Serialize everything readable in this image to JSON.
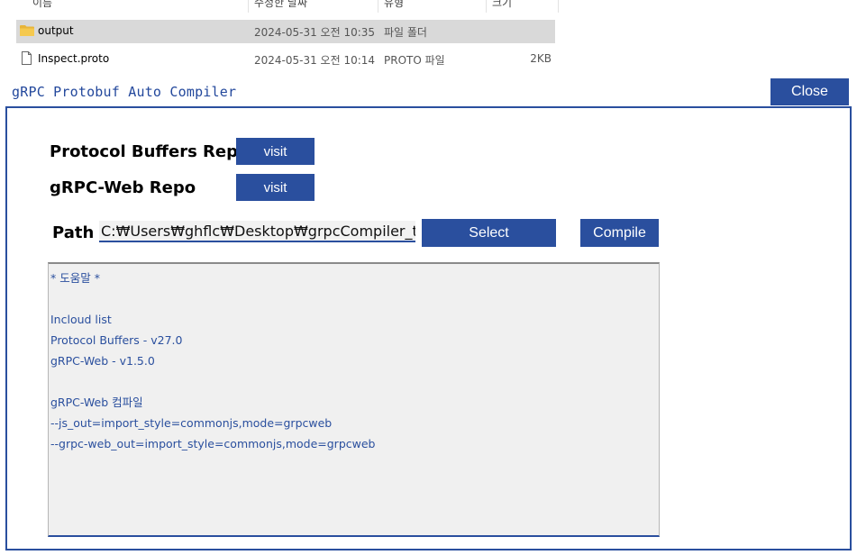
{
  "explorer": {
    "columns": [
      "이름",
      "수정한 날짜",
      "유형",
      "크기"
    ],
    "files": [
      {
        "name": "output",
        "date": "2024-05-31 오전 10:35",
        "type": "파일 폴더",
        "size": "",
        "kind": "folder",
        "selected": true
      },
      {
        "name": "Inspect.proto",
        "date": "2024-05-31 오전 10:14",
        "type": "PROTO 파일",
        "size": "2KB",
        "kind": "file",
        "selected": false
      }
    ]
  },
  "app": {
    "title": "gRPC Protobuf Auto Compiler",
    "close_label": "Close",
    "repos": [
      {
        "label": "Protocol Buffers Repo",
        "button": "visit"
      },
      {
        "label": "gRPC-Web Repo",
        "button": "visit"
      }
    ],
    "path": {
      "label": "Path",
      "value": "C:₩Users₩ghflc₩Desktop₩grpcCompiler_test"
    },
    "select_label": "Select",
    "compile_label": "Compile",
    "help_lines": [
      "* 도움말 *",
      "",
      "Incloud list",
      "Protocol Buffers - v27.0",
      "gRPC-Web - v1.5.0",
      "",
      "gRPC-Web 컴파일",
      "--js_out=import_style=commonjs,mode=grpcweb",
      "--grpc-web_out=import_style=commonjs,mode=grpcweb"
    ],
    "accent_color": "#2a4f9e"
  }
}
